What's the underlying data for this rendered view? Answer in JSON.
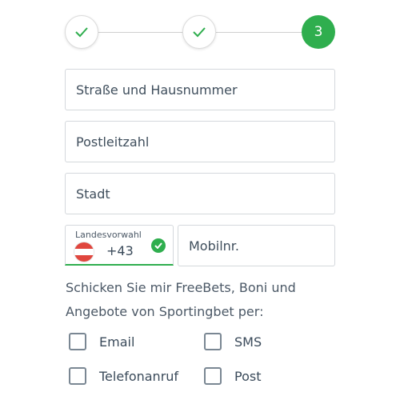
{
  "stepper": {
    "steps": [
      {
        "state": "completed",
        "icon": "check-icon"
      },
      {
        "state": "completed",
        "icon": "check-icon"
      },
      {
        "state": "active",
        "number": "3"
      }
    ],
    "active_color": "#2fae4e"
  },
  "form": {
    "street_placeholder": "Straße und Hausnummer",
    "postcode_placeholder": "Postleitzahl",
    "city_placeholder": "Stadt",
    "phone_code": {
      "label": "Landesvorwahl",
      "value": "+43",
      "flag": "austria-flag-icon",
      "valid_icon": "check-circle-icon"
    },
    "mobile_placeholder": "Mobilnr."
  },
  "consent": {
    "text": "Schicken Sie mir FreeBets, Boni und Angebote von Sportingbet per:",
    "options": [
      {
        "label": "Email",
        "checked": false
      },
      {
        "label": "SMS",
        "checked": false
      },
      {
        "label": "Telefonanruf",
        "checked": false
      },
      {
        "label": "Post",
        "checked": false
      }
    ]
  }
}
